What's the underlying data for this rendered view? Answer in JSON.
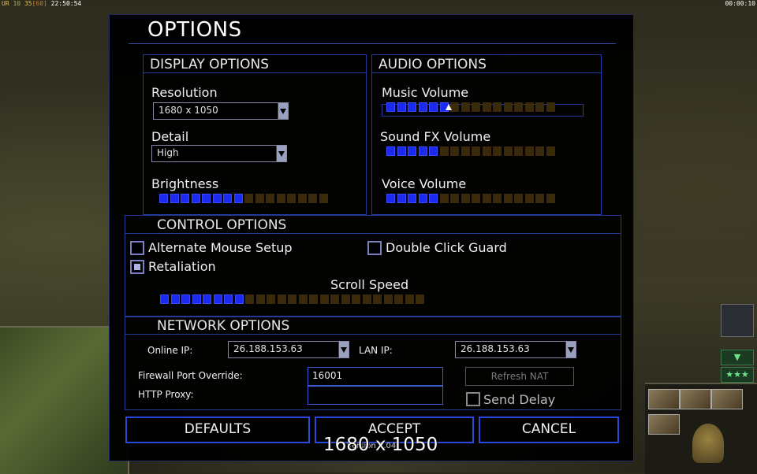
{
  "hud": {
    "top_left": [
      "UR",
      "10",
      "35",
      "[60]",
      "22:50:54"
    ],
    "top_right": "00:00:10"
  },
  "dialog": {
    "title": "OPTIONS"
  },
  "display": {
    "header": "DISPLAY OPTIONS",
    "resolution_label": "Resolution",
    "resolution_value": "1680 x 1050",
    "detail_label": "Detail",
    "detail_value": "High",
    "brightness_label": "Brightness",
    "brightness_level": 0.5
  },
  "audio": {
    "header": "AUDIO OPTIONS",
    "music_label": "Music Volume",
    "music_level": 0.375,
    "sfx_label": "Sound FX Volume",
    "sfx_level": 0.3125,
    "voice_label": "Voice Volume",
    "voice_level": 0.3125
  },
  "control": {
    "header": "CONTROL OPTIONS",
    "alt_mouse_label": "Alternate Mouse Setup",
    "alt_mouse_checked": false,
    "double_click_label": "Double Click Guard",
    "double_click_checked": false,
    "retaliation_label": "Retaliation",
    "retaliation_checked": true,
    "scroll_label": "Scroll Speed",
    "scroll_level": 0.32
  },
  "network": {
    "header": "NETWORK OPTIONS",
    "online_ip_label": "Online IP:",
    "online_ip_value": "26.188.153.63",
    "lan_ip_label": "LAN IP:",
    "lan_ip_value": "26.188.153.63",
    "firewall_label": "Firewall Port Override:",
    "firewall_value": "16001",
    "proxy_label": "HTTP Proxy:",
    "proxy_value": "",
    "refresh_nat_label": "Refresh NAT",
    "send_delay_label": "Send Delay",
    "send_delay_checked": false
  },
  "buttons": {
    "defaults": "DEFAULTS",
    "accept": "ACCEPT",
    "cancel": "CANCEL"
  },
  "tooltip": "1680 x 1050",
  "version": "Version 1.04"
}
